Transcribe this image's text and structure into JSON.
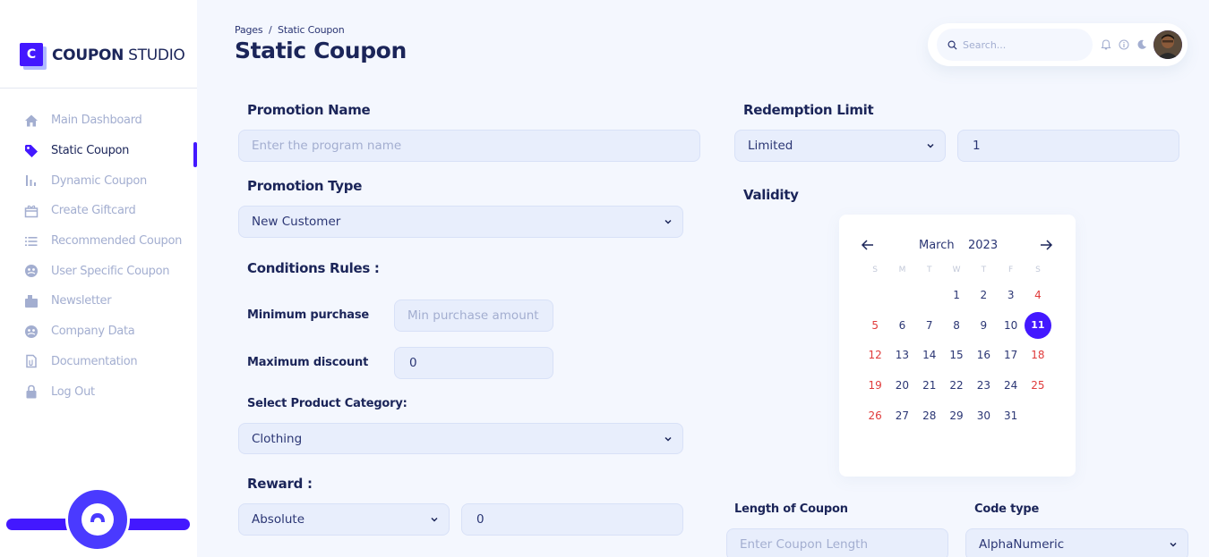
{
  "brand": {
    "logo_letter": "C",
    "name_bold": "COUPON",
    "name_light": " STUDIO",
    "accent": "#4318ff"
  },
  "sidebar": {
    "items": [
      {
        "label": "Main Dashboard",
        "icon": "home-icon",
        "active": false
      },
      {
        "label": "Static Coupon",
        "icon": "tag-icon",
        "active": true
      },
      {
        "label": "Dynamic Coupon",
        "icon": "bar-chart-icon",
        "active": false
      },
      {
        "label": "Create Giftcard",
        "icon": "gift-icon",
        "active": false
      },
      {
        "label": "Recommended Coupon",
        "icon": "list-icon",
        "active": false
      },
      {
        "label": "User Specific Coupon",
        "icon": "user-circle-icon",
        "active": false
      },
      {
        "label": "Newsletter",
        "icon": "newsletter-icon",
        "active": false
      },
      {
        "label": "Company Data",
        "icon": "company-icon",
        "active": false
      },
      {
        "label": "Documentation",
        "icon": "document-icon",
        "active": false
      },
      {
        "label": "Log Out",
        "icon": "lock-icon",
        "active": false
      }
    ]
  },
  "header": {
    "breadcrumb": "Pages  /  Static Coupon",
    "title": "Static Coupon",
    "search_placeholder": "Search..."
  },
  "form": {
    "promotion_name": {
      "label": "Promotion Name",
      "placeholder": "Enter the program name"
    },
    "promotion_type": {
      "label": "Promotion Type",
      "value": "New Customer"
    },
    "conditions_label": "Conditions Rules :",
    "minimum_purchase": {
      "label": "Minimum purchase",
      "placeholder": "Min purchase amount"
    },
    "maximum_discount": {
      "label": "Maximum discount",
      "value": "0"
    },
    "product_category": {
      "label": "Select Product Category:",
      "value": "Clothing"
    },
    "reward": {
      "label": "Reward :",
      "type": "Absolute",
      "value": "0"
    },
    "redemption_limit": {
      "label": "Redemption Limit",
      "type": "Limited",
      "value": "1"
    },
    "validity_label": "Validity",
    "length_of_coupon": {
      "label": "Length of Coupon",
      "placeholder": "Enter Coupon Length"
    },
    "code_type": {
      "label": "Code type",
      "value": "AlphaNumeric"
    }
  },
  "calendar": {
    "month": "March",
    "year": "2023",
    "weekdays": [
      "S",
      "M",
      "T",
      "W",
      "T",
      "F",
      "S"
    ],
    "selected": "11",
    "weeks": [
      [
        "",
        "",
        "",
        "1",
        "2",
        "3",
        "4"
      ],
      [
        "5",
        "6",
        "7",
        "8",
        "9",
        "10",
        "11"
      ],
      [
        "12",
        "13",
        "14",
        "15",
        "16",
        "17",
        "18"
      ],
      [
        "19",
        "20",
        "21",
        "22",
        "23",
        "24",
        "25"
      ],
      [
        "26",
        "27",
        "28",
        "29",
        "30",
        "31",
        ""
      ]
    ]
  }
}
